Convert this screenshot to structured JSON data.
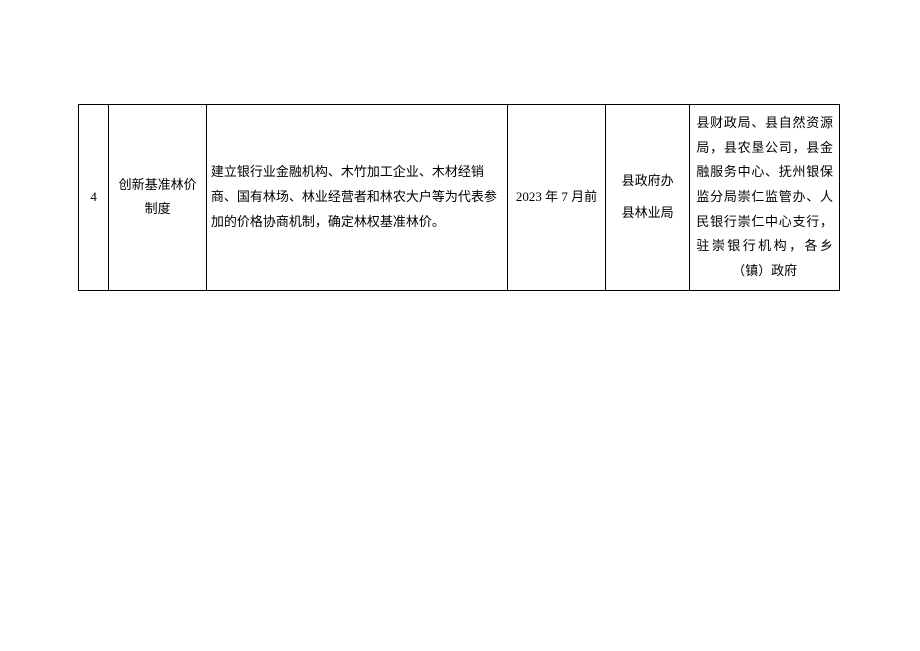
{
  "table": {
    "rows": [
      {
        "num": "4",
        "title": "创新基准林价制度",
        "desc": "建立银行业金融机构、木竹加工企业、木材经销商、国有林场、林业经营者和林农大户等为代表参加的价格协商机制，确定林权基准林价。",
        "date": "2023 年 7 月前",
        "dept1_line1": "县政府办",
        "dept1_line2": "县林业局",
        "dept2": "县财政局、县自然资源局，县农垦公司，县金融服务中心、抚州银保监分局崇仁监管办、人民银行崇仁中心支行，驻崇银行机构，各乡（镇）政府"
      }
    ]
  }
}
